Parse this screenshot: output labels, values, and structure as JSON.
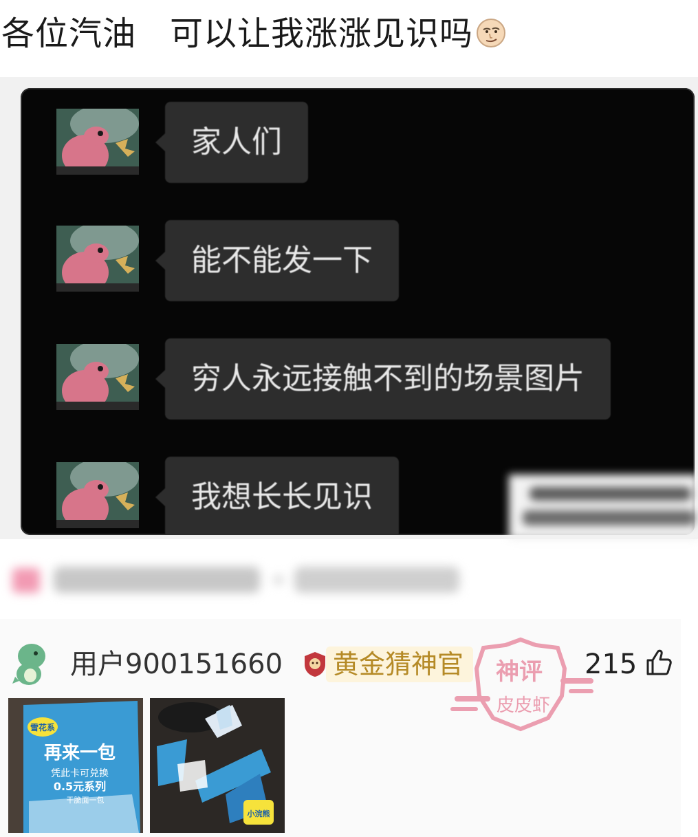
{
  "post": {
    "title": "各位汽油　可以让我涨涨见识吗",
    "title_emoji": "smirk-face-emoji"
  },
  "chat": {
    "messages": [
      {
        "text": "家人们"
      },
      {
        "text": "能不能发一下"
      },
      {
        "text": "穷人永远接触不到的场景图片"
      },
      {
        "text": "我想长长见识"
      }
    ]
  },
  "comment": {
    "username": "用户900151660",
    "badge": "黄金猜神官",
    "likes": "215",
    "stamp_lines": [
      "神评",
      "皮皮虾"
    ],
    "photo1": {
      "brand": "雪花系",
      "headline": "再来一包",
      "line1": "凭此卡可兑换",
      "line2": "0.5元系列",
      "line3": "干脆面一包"
    },
    "photo2": {
      "brand": "小浣熊"
    }
  },
  "colors": {
    "chat_bg": "#060606",
    "bubble_bg": "#2d2d2d",
    "badge_bg": "#fdf4dc",
    "badge_text": "#b58a26",
    "stamp_pink": "#e8889e"
  }
}
